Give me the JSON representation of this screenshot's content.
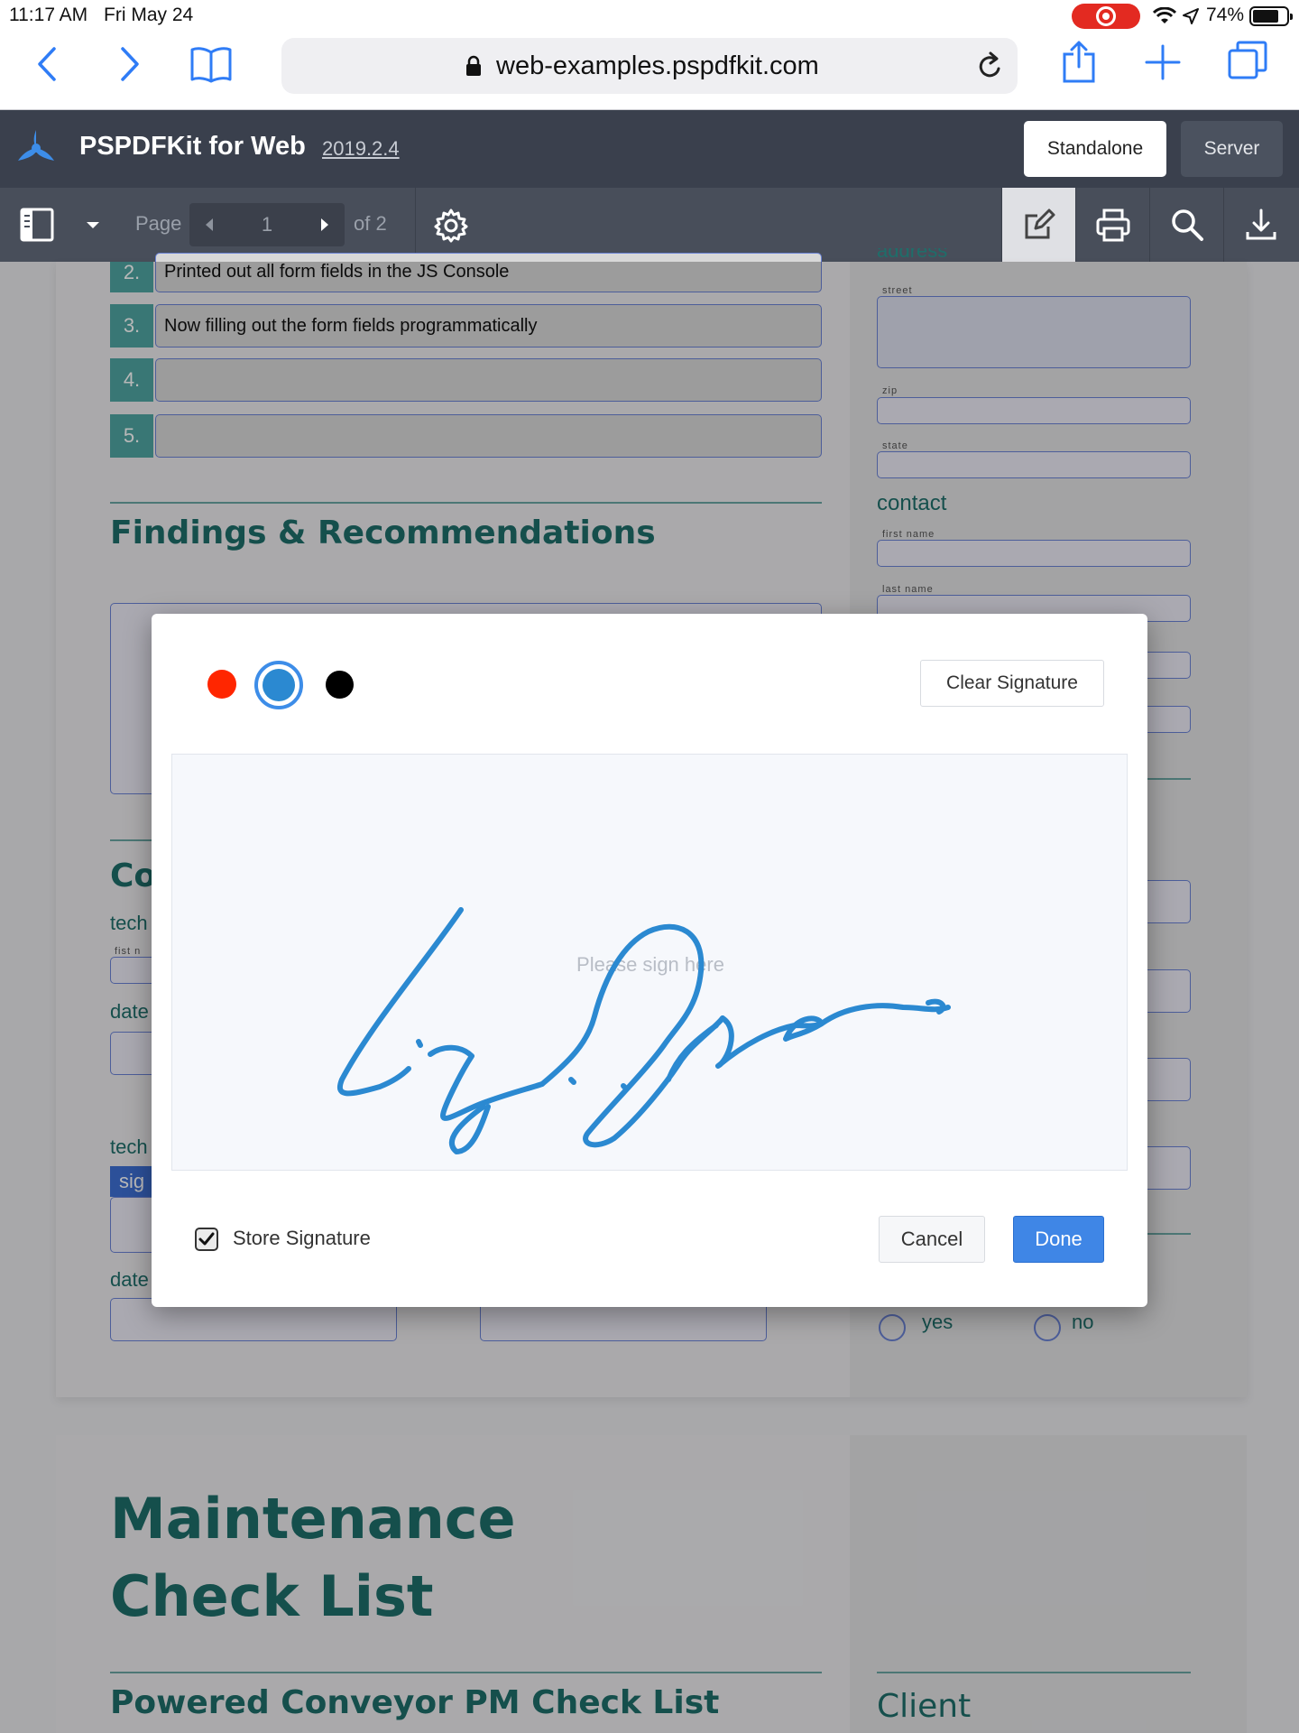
{
  "status_bar": {
    "time": "11:17 AM",
    "date": "Fri May 24",
    "battery": "74%"
  },
  "browser": {
    "url": "web-examples.pspdfkit.com",
    "icons": [
      "back-icon",
      "forward-icon",
      "bookmarks-icon",
      "lock-icon",
      "reload-icon",
      "share-icon",
      "new-tab-icon",
      "tabs-icon"
    ]
  },
  "app": {
    "title": "PSPDFKit for Web",
    "version": "2019.2.4",
    "mode_standalone": "Standalone",
    "mode_server": "Server"
  },
  "toolbar": {
    "page_label": "Page",
    "page_value": "1",
    "page_of": "of 2"
  },
  "document": {
    "rows": [
      {
        "num": "2.",
        "text": "Printed out all form fields in the JS Console"
      },
      {
        "num": "3.",
        "text": "Now filling out the form fields programmatically"
      },
      {
        "num": "4.",
        "text": ""
      },
      {
        "num": "5.",
        "text": ""
      }
    ],
    "findings_title": "Findings & Recommendations",
    "address_heading": "address",
    "street_label": "street",
    "zip_label": "zip",
    "state_label": "state",
    "contact_heading": "contact",
    "first_name_label": "first name",
    "last_name_label": "last name",
    "co_partial": "Co",
    "tech_partial": "tech",
    "fist_partial": "fist n",
    "date_partial": "date",
    "tech_partial_2": "tech",
    "sig_partial": "sig",
    "date_partial_2": "date",
    "yes_label": "yes",
    "no_label": "no",
    "page2_title_line1": "Maintenance",
    "page2_title_line2": "Check List",
    "page2_subtitle": "Powered Conveyor PM Check List",
    "page2_client": "Client"
  },
  "signature_dialog": {
    "colors": [
      "#ff2600",
      "#2b89d1",
      "#000000"
    ],
    "selected_color": "#2b89d1",
    "clear_label": "Clear Signature",
    "placeholder": "Please sign here",
    "store_label": "Store Signature",
    "store_checked": true,
    "cancel_label": "Cancel",
    "done_label": "Done"
  }
}
